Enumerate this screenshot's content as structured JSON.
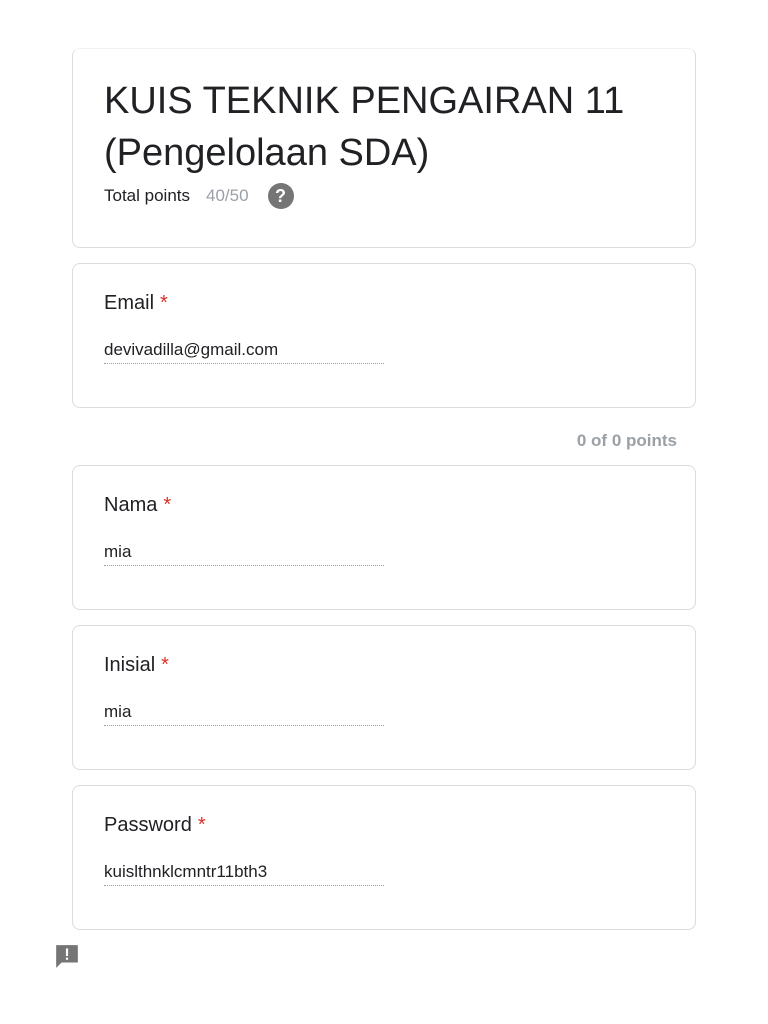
{
  "form": {
    "title": "KUIS TEKNIK PENGAIRAN 11 (Pengelolaan SDA)",
    "total_points_label": "Total points",
    "total_points_value": "40/50",
    "help_icon": "help-circle-icon"
  },
  "section": {
    "points": "0 of 0 points"
  },
  "questions": [
    {
      "label": "Email",
      "required": "*",
      "answer": "devivadilla@gmail.com"
    },
    {
      "label": "Nama",
      "required": "*",
      "answer": "mia"
    },
    {
      "label": "Inisial",
      "required": "*",
      "answer": "mia"
    },
    {
      "label": "Password",
      "required": "*",
      "answer": "kuislthnklcmntr11bth3"
    }
  ],
  "footer": {
    "report_icon": "report-problem-icon"
  },
  "colors": {
    "required": "#d93025",
    "muted": "#9aa0a6",
    "border": "#dadce0",
    "icon": "#757575"
  }
}
